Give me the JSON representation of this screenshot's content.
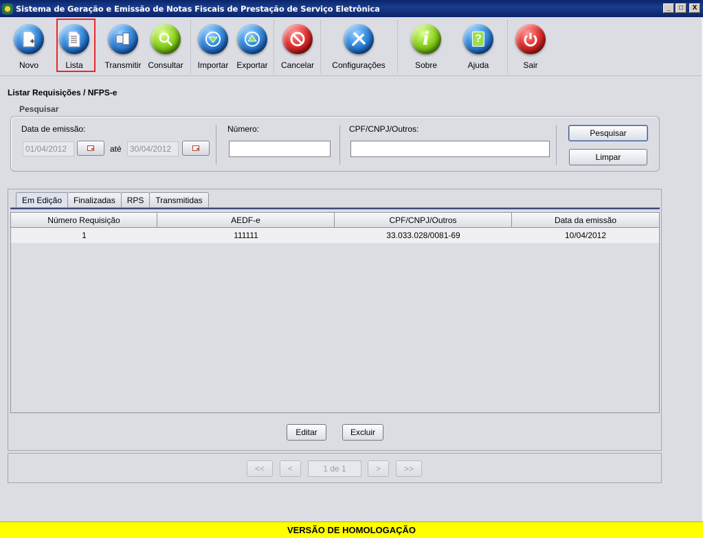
{
  "window": {
    "title": "Sistema de Geração e Emissão de Notas Fiscais de Prestação de Serviço Eletrônica",
    "buttons": {
      "minimize": "_",
      "maximize": "□",
      "close": "X"
    }
  },
  "toolbar": {
    "items": [
      {
        "label": "Novo",
        "icon": "new-document-icon"
      },
      {
        "label": "Lista",
        "icon": "list-document-icon",
        "selected": true
      },
      {
        "label": "Transmitir",
        "icon": "transmit-icon"
      },
      {
        "label": "Consultar",
        "icon": "magnifier-icon"
      },
      {
        "label": "Importar",
        "icon": "import-arrow-down-icon"
      },
      {
        "label": "Exportar",
        "icon": "export-arrow-up-icon"
      },
      {
        "label": "Cancelar",
        "icon": "cancel-icon"
      },
      {
        "label": "Configurações",
        "icon": "tools-icon"
      },
      {
        "label": "Sobre",
        "icon": "info-icon"
      },
      {
        "label": "Ajuda",
        "icon": "help-icon"
      },
      {
        "label": "Sair",
        "icon": "power-icon"
      }
    ]
  },
  "page": {
    "title": "Listar Requisições / NFPS-e",
    "search": {
      "title": "Pesquisar",
      "date_label": "Data de emissão:",
      "date_from": "01/04/2012",
      "between": "até",
      "date_to": "30/04/2012",
      "numero_label": "Número:",
      "numero_value": "",
      "cpf_label": "CPF/CNPJ/Outros:",
      "cpf_value": "",
      "search_button": "Pesquisar",
      "clear_button": "Limpar"
    },
    "tabs": [
      "Em Edição",
      "Finalizadas",
      "RPS",
      "Transmitidas"
    ],
    "active_tab": "Em Edição",
    "table": {
      "columns": [
        "Número Requisição",
        "AEDF-e",
        "CPF/CNPJ/Outros",
        "Data da emissão"
      ],
      "rows": [
        [
          "1",
          "111111",
          "33.033.028/0081-69",
          "10/04/2012"
        ]
      ]
    },
    "actions": {
      "edit": "Editar",
      "delete": "Excluir"
    },
    "pager": {
      "first": "<<",
      "prev": "<",
      "page": "1 de 1",
      "next": ">",
      "last": ">>"
    }
  },
  "footer": {
    "text": "VERSÃO DE HOMOLOGAÇÃO"
  },
  "colors": {
    "titlebar": "#0a246a",
    "selection": "#e8272a",
    "footer": "#ffff00"
  }
}
